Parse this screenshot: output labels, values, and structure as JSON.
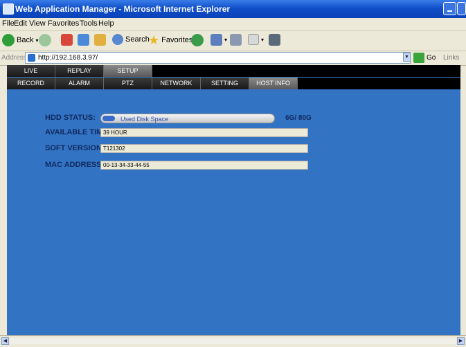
{
  "window": {
    "title": "Web Application Manager - Microsoft Internet Explorer"
  },
  "menu": [
    "File",
    "Edit",
    "View",
    "Favorites",
    "Tools",
    "Help"
  ],
  "toolbar": {
    "back_label": "Back",
    "search_label": "Search",
    "favorites_label": "Favorites"
  },
  "address": {
    "label": "Address",
    "url": "http://192.168.3.97/",
    "go_label": "Go",
    "links_label": "Links"
  },
  "nav_top": [
    {
      "label": "LIVE",
      "active": false
    },
    {
      "label": "REPLAY",
      "active": false
    },
    {
      "label": "SETUP",
      "active": true
    }
  ],
  "nav_sub": [
    {
      "label": "RECORD",
      "active": false
    },
    {
      "label": "ALARM",
      "active": false
    },
    {
      "label": "PTZ",
      "active": false
    },
    {
      "label": "NETWORK",
      "active": false
    },
    {
      "label": "SETTING",
      "active": false
    },
    {
      "label": "HOST INFO",
      "active": true
    }
  ],
  "host_info": {
    "hdd_status_label": "HDD STATUS:",
    "hdd_bar_text": "Used Disk Space",
    "hdd_used_fraction": 0.075,
    "hdd_capacity": "6G/ 80G",
    "available_time_label": "AVAILABLE TIME",
    "available_time": "39 HOUR",
    "soft_version_label": "SOFT VERSION",
    "soft_version": "T121302",
    "mac_address_label": "MAC ADDRESS",
    "mac_address": "00-13-34-33-44-55"
  },
  "colors": {
    "content_bg": "#3373c4",
    "titlebar": "#0a42b8",
    "label_text": "#0f2a5e"
  }
}
